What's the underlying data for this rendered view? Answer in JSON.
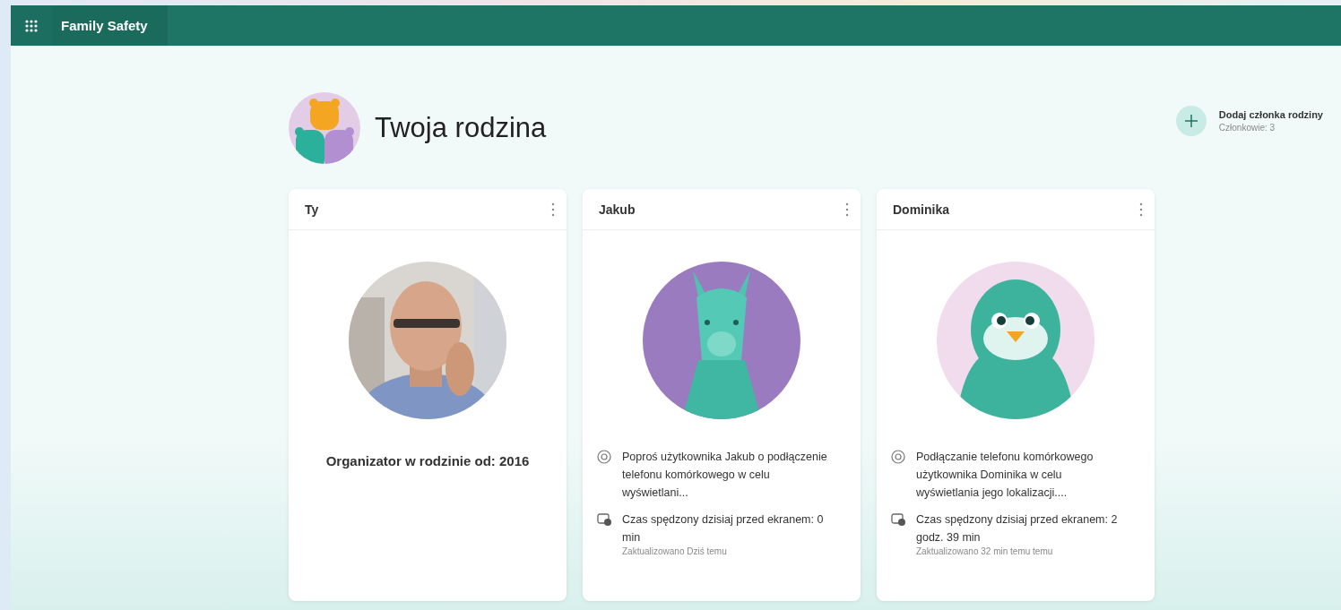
{
  "app_bar": {
    "title": "Family Safety"
  },
  "family": {
    "title": "Twoja rodzina",
    "add_member": {
      "label": "Dodaj członka rodziny",
      "count": "Członkowie: 3"
    }
  },
  "members": [
    {
      "kind": "self",
      "name": "Ty",
      "role": "Organizator w rodzinie od: 2016"
    },
    {
      "kind": "child",
      "name": "Jakub",
      "avatar": {
        "kind": "llama"
      },
      "location": "Poproś użytkownika Jakub o podłączenie telefonu komórkowego w celu wyświetlani...",
      "screen_time": "Czas spędzony dzisiaj przed ekranem: 0 min",
      "updated": "Zaktualizowano Dziś temu"
    },
    {
      "kind": "child",
      "name": "Dominika",
      "avatar": {
        "kind": "penguin"
      },
      "location": "Podłączanie telefonu komórkowego użytkownika Dominika w celu wyświetlania jego lokalizacji....",
      "screen_time": "Czas spędzony dzisiaj przed ekranem: 2 godz. 39 min",
      "updated": "Zaktualizowano 32 min temu temu"
    }
  ]
}
